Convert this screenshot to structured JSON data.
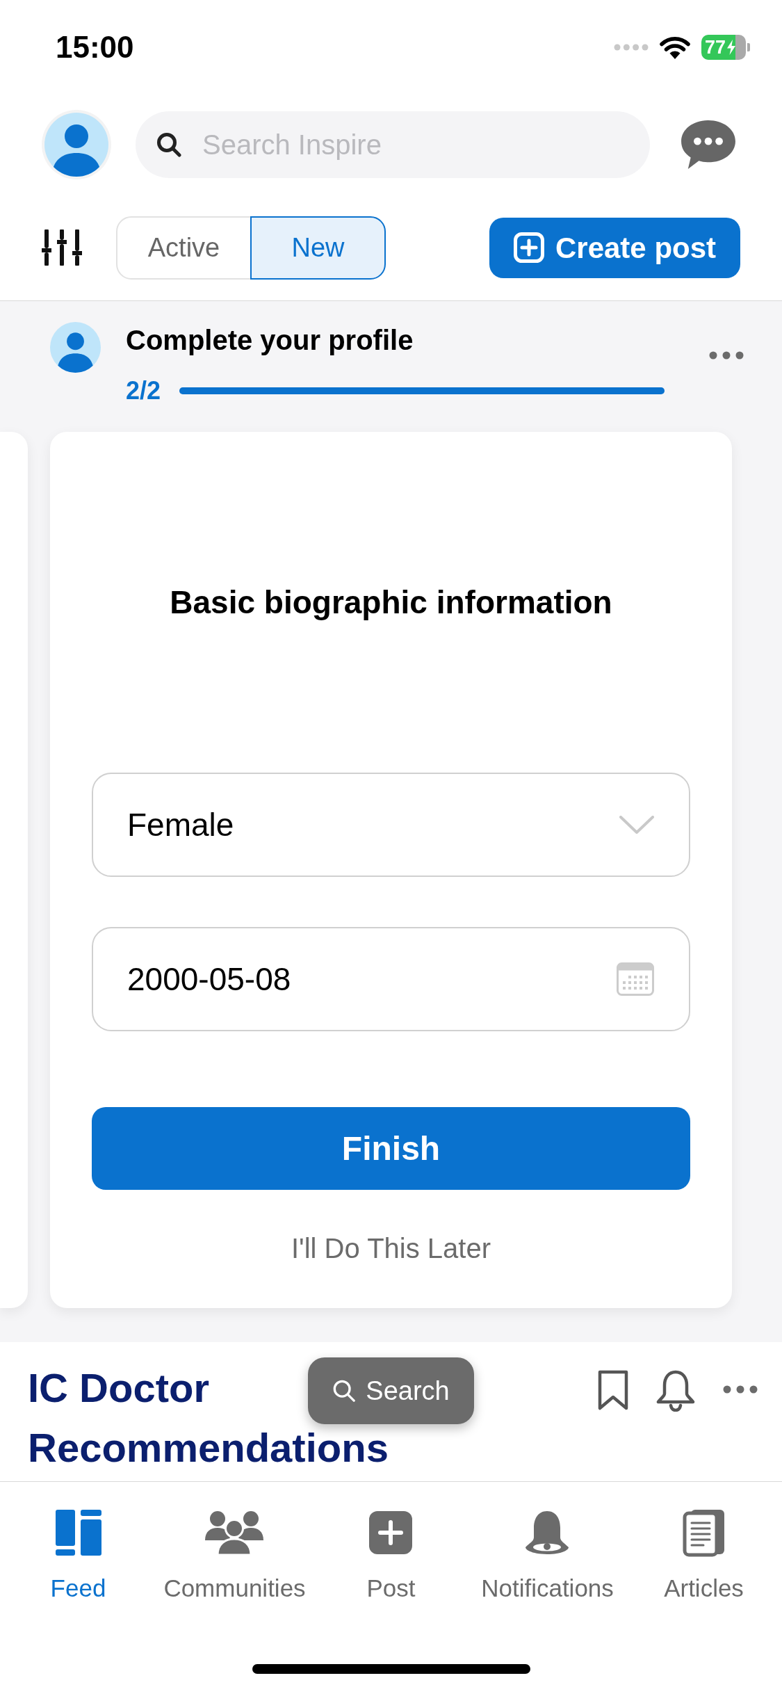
{
  "status_bar": {
    "time": "15:00",
    "battery": "77",
    "charging": true
  },
  "header": {
    "search": {
      "placeholder": "Search Inspire"
    }
  },
  "toolbar": {
    "tabs": [
      {
        "label": "Active",
        "selected": false
      },
      {
        "label": "New",
        "selected": true
      }
    ],
    "create_button": "Create post"
  },
  "profile_prompt": {
    "title": "Complete your profile",
    "progress": "2/2",
    "level": 1
  },
  "card": {
    "title": "Basic biographic information",
    "fields": [
      {
        "kind": "select",
        "value": "Female"
      },
      {
        "kind": "date",
        "value": "2000-05-08"
      }
    ],
    "finish_button": "Finish",
    "later_link": "I'll Do This Later"
  },
  "section": {
    "title_lines": [
      "IC Doctor",
      "Recommendations"
    ]
  },
  "toast": {
    "label": "Search"
  },
  "tab_bar": [
    {
      "kind": "feed",
      "label": "Feed",
      "selected": true
    },
    {
      "kind": "communities",
      "label": "Communities",
      "selected": false
    },
    {
      "kind": "post",
      "label": "Post",
      "selected": false
    },
    {
      "kind": "notifications",
      "label": "Notifications",
      "selected": false
    },
    {
      "kind": "articles",
      "label": "Articles",
      "selected": false
    }
  ]
}
